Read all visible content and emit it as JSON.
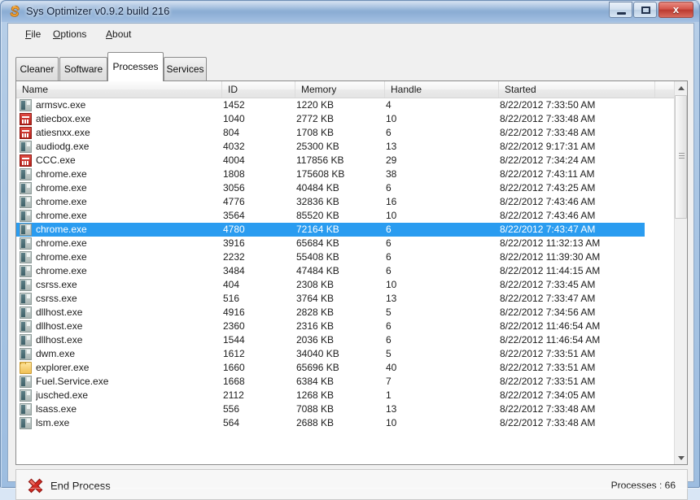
{
  "window": {
    "title": "Sys Optimizer v0.9.2 build 216",
    "icon": "app-s-icon",
    "controls": {
      "minimize": "minimize-button",
      "maximize": "maximize-button",
      "close_label": "x"
    }
  },
  "menu": {
    "items": [
      {
        "label": "File",
        "accesskey": "F"
      },
      {
        "label": "Options",
        "accesskey": "O"
      },
      {
        "label": "About",
        "accesskey": "A"
      }
    ]
  },
  "tabs": {
    "active": "Processes",
    "items": [
      {
        "label": "Cleaner"
      },
      {
        "label": "Software"
      },
      {
        "label": "Processes"
      },
      {
        "label": "Services"
      }
    ]
  },
  "table": {
    "columns": [
      "Name",
      "ID",
      "Memory",
      "Handle",
      "Started"
    ],
    "selected_index": 9,
    "rows": [
      {
        "icon": "app-icon",
        "name": "armsvc.exe",
        "id": "1452",
        "memory": "1220 KB",
        "handle": "4",
        "started": "8/22/2012 7:33:50 AM"
      },
      {
        "icon": "ati-icon",
        "name": "atiecbox.exe",
        "id": "1040",
        "memory": "2772 KB",
        "handle": "10",
        "started": "8/22/2012 7:33:48 AM"
      },
      {
        "icon": "ati-icon",
        "name": "atiesnxx.exe",
        "id": "804",
        "memory": "1708 KB",
        "handle": "6",
        "started": "8/22/2012 7:33:48 AM"
      },
      {
        "icon": "app-icon",
        "name": "audiodg.exe",
        "id": "4032",
        "memory": "25300 KB",
        "handle": "13",
        "started": "8/22/2012 9:17:31 AM"
      },
      {
        "icon": "ati-icon",
        "name": "CCC.exe",
        "id": "4004",
        "memory": "117856 KB",
        "handle": "29",
        "started": "8/22/2012 7:34:24 AM"
      },
      {
        "icon": "app-icon",
        "name": "chrome.exe",
        "id": "1808",
        "memory": "175608 KB",
        "handle": "38",
        "started": "8/22/2012 7:43:11 AM"
      },
      {
        "icon": "app-icon",
        "name": "chrome.exe",
        "id": "3056",
        "memory": "40484 KB",
        "handle": "6",
        "started": "8/22/2012 7:43:25 AM"
      },
      {
        "icon": "app-icon",
        "name": "chrome.exe",
        "id": "4776",
        "memory": "32836 KB",
        "handle": "16",
        "started": "8/22/2012 7:43:46 AM"
      },
      {
        "icon": "app-icon",
        "name": "chrome.exe",
        "id": "3564",
        "memory": "85520 KB",
        "handle": "10",
        "started": "8/22/2012 7:43:46 AM"
      },
      {
        "icon": "app-icon",
        "name": "chrome.exe",
        "id": "4780",
        "memory": "72164 KB",
        "handle": "6",
        "started": "8/22/2012 7:43:47 AM"
      },
      {
        "icon": "app-icon",
        "name": "chrome.exe",
        "id": "3916",
        "memory": "65684 KB",
        "handle": "6",
        "started": "8/22/2012 11:32:13 AM"
      },
      {
        "icon": "app-icon",
        "name": "chrome.exe",
        "id": "2232",
        "memory": "55408 KB",
        "handle": "6",
        "started": "8/22/2012 11:39:30 AM"
      },
      {
        "icon": "app-icon",
        "name": "chrome.exe",
        "id": "3484",
        "memory": "47484 KB",
        "handle": "6",
        "started": "8/22/2012 11:44:15 AM"
      },
      {
        "icon": "app-icon",
        "name": "csrss.exe",
        "id": "404",
        "memory": "2308 KB",
        "handle": "10",
        "started": "8/22/2012 7:33:45 AM"
      },
      {
        "icon": "app-icon",
        "name": "csrss.exe",
        "id": "516",
        "memory": "3764 KB",
        "handle": "13",
        "started": "8/22/2012 7:33:47 AM"
      },
      {
        "icon": "app-icon",
        "name": "dllhost.exe",
        "id": "4916",
        "memory": "2828 KB",
        "handle": "5",
        "started": "8/22/2012 7:34:56 AM"
      },
      {
        "icon": "app-icon",
        "name": "dllhost.exe",
        "id": "2360",
        "memory": "2316 KB",
        "handle": "6",
        "started": "8/22/2012 11:46:54 AM"
      },
      {
        "icon": "app-icon",
        "name": "dllhost.exe",
        "id": "1544",
        "memory": "2036 KB",
        "handle": "6",
        "started": "8/22/2012 11:46:54 AM"
      },
      {
        "icon": "app-icon",
        "name": "dwm.exe",
        "id": "1612",
        "memory": "34040 KB",
        "handle": "5",
        "started": "8/22/2012 7:33:51 AM"
      },
      {
        "icon": "folder-icon",
        "name": "explorer.exe",
        "id": "1660",
        "memory": "65696 KB",
        "handle": "40",
        "started": "8/22/2012 7:33:51 AM"
      },
      {
        "icon": "app-icon",
        "name": "Fuel.Service.exe",
        "id": "1668",
        "memory": "6384 KB",
        "handle": "7",
        "started": "8/22/2012 7:33:51 AM"
      },
      {
        "icon": "app-icon",
        "name": "jusched.exe",
        "id": "2112",
        "memory": "1268 KB",
        "handle": "1",
        "started": "8/22/2012 7:34:05 AM"
      },
      {
        "icon": "app-icon",
        "name": "lsass.exe",
        "id": "556",
        "memory": "7088 KB",
        "handle": "13",
        "started": "8/22/2012 7:33:48 AM"
      },
      {
        "icon": "app-icon",
        "name": "lsm.exe",
        "id": "564",
        "memory": "2688 KB",
        "handle": "10",
        "started": "8/22/2012 7:33:48 AM"
      }
    ]
  },
  "statusbar": {
    "end_process_label": "End Process",
    "end_process_icon": "red-x-icon",
    "process_count": "Processes : 66"
  },
  "colors": {
    "selection": "#2a9cf0",
    "titlebar": "#8badd4",
    "close_button": "#bb3a30"
  }
}
